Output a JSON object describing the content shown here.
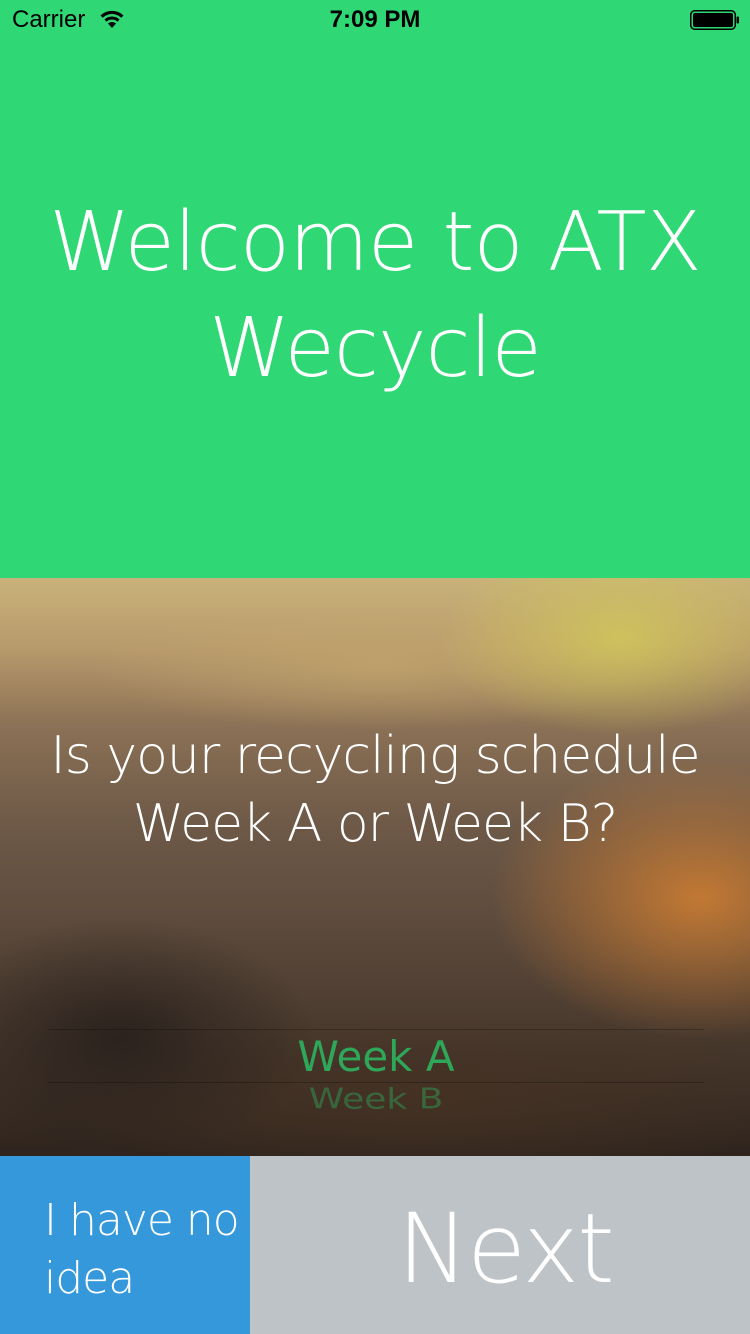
{
  "status_bar": {
    "carrier": "Carrier",
    "time": "7:09 PM",
    "wifi_icon": "wifi-icon",
    "battery_icon": "battery-icon"
  },
  "hero": {
    "title": "Welcome to ATX Wecycle",
    "background_color": "#2fd874"
  },
  "schedule": {
    "question": "Is your recycling schedule Week A or Week B?",
    "picker": {
      "selected": "Week A",
      "next_option": "Week B",
      "accent_color": "#2ea759"
    }
  },
  "buttons": {
    "no_idea_label": "I have no idea",
    "no_idea_color": "#3598db",
    "next_label": "Next",
    "next_color": "#bec3c7"
  }
}
